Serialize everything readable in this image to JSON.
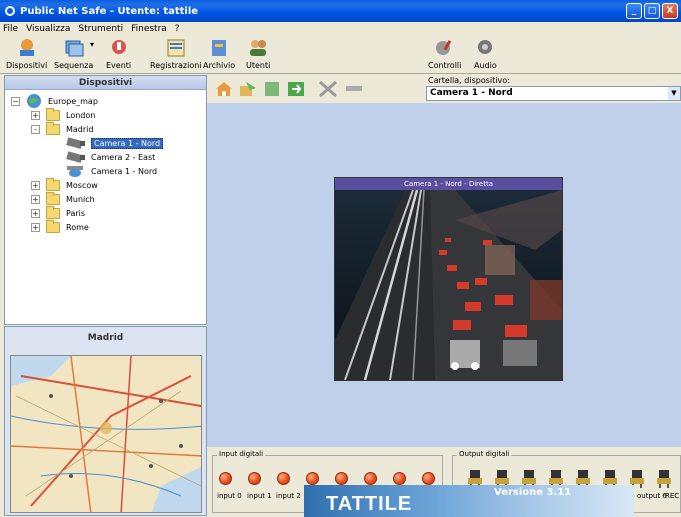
{
  "window": {
    "title": "Public Net Safe - Utente: tattile",
    "buttons": [
      "_",
      "□",
      "X"
    ]
  },
  "menu": [
    "File",
    "Visualizza",
    "Strumenti",
    "Finestra",
    "?"
  ],
  "toolbar": {
    "items": [
      {
        "label": "Dispositivi",
        "icon": "devices-icon"
      },
      {
        "label": "Sequenza",
        "icon": "sequence-icon"
      },
      {
        "label": "Eventi",
        "icon": "events-icon"
      },
      {
        "label": "Registrazioni",
        "icon": "recordings-icon"
      },
      {
        "label": "Archivio",
        "icon": "archive-icon"
      },
      {
        "label": "Utenti",
        "icon": "users-icon"
      },
      {
        "label": "Controlli",
        "icon": "controls-icon"
      },
      {
        "label": "Audio",
        "icon": "audio-icon"
      }
    ]
  },
  "devices_panel": {
    "title": "Dispositivi",
    "tree": {
      "root": "Europe_map",
      "nodes": [
        {
          "label": "London",
          "expander": "+"
        },
        {
          "label": "Madrid",
          "expander": "-"
        },
        {
          "label": "Camera 1 - Nord",
          "selected": true
        },
        {
          "label": "Camera 2 - East"
        },
        {
          "label": "Camera 1 - Nord"
        },
        {
          "label": "Moscow",
          "expander": "+"
        },
        {
          "label": "Munich",
          "expander": "+"
        },
        {
          "label": "Paris",
          "expander": "+"
        },
        {
          "label": "Rome",
          "expander": "+"
        }
      ]
    }
  },
  "map_panel": {
    "title": "Madrid"
  },
  "device_selector": {
    "label": "Cartella, dispositivo:",
    "value": "Camera 1 - Nord"
  },
  "video": {
    "title": "Camera 1 - Nord - Diretta"
  },
  "io": {
    "inputs_label": "Input digitali",
    "outputs_label": "Output digitali",
    "input_labels": [
      "input 0",
      "input 1",
      "input 2"
    ],
    "output_labels": [
      "output 6",
      "REC"
    ]
  },
  "splash": {
    "brand": "TATTILE",
    "version": "Versione 3.11"
  },
  "colors": {
    "titlebar": "#0054E3",
    "selection": "#316AC5",
    "led": "#E8501E",
    "video_title": "#5A4E9E"
  }
}
